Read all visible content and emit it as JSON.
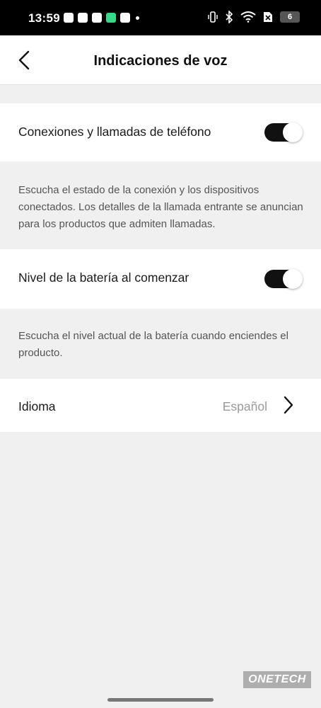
{
  "status_bar": {
    "time": "13:59",
    "battery_level": "6",
    "notification_icons": [
      "app-icon",
      "youtube-icon",
      "capcut-icon",
      "phone-green-icon",
      "app-icon",
      "dot-icon"
    ],
    "system_icons": [
      "vibrate-icon",
      "bluetooth-icon",
      "wifi-icon",
      "no-sim-icon",
      "battery-icon"
    ]
  },
  "header": {
    "title": "Indicaciones de voz"
  },
  "settings": {
    "connections": {
      "label": "Conexiones y llamadas de teléfono",
      "enabled": true,
      "description": "Escucha el estado de la conexión y los dispositivos conectados. Los detalles de la llamada entrante se anuncian para los productos que admiten llamadas."
    },
    "battery": {
      "label": "Nivel de la batería al comenzar",
      "enabled": true,
      "description": "Escucha el nivel actual de la batería cuando enciendes el producto."
    },
    "language": {
      "label": "Idioma",
      "value": "Español"
    }
  },
  "watermark": "ONETECH",
  "colors": {
    "toggle_on": "#111111",
    "page_background": "#f0f0f0",
    "row_background": "#ffffff"
  }
}
